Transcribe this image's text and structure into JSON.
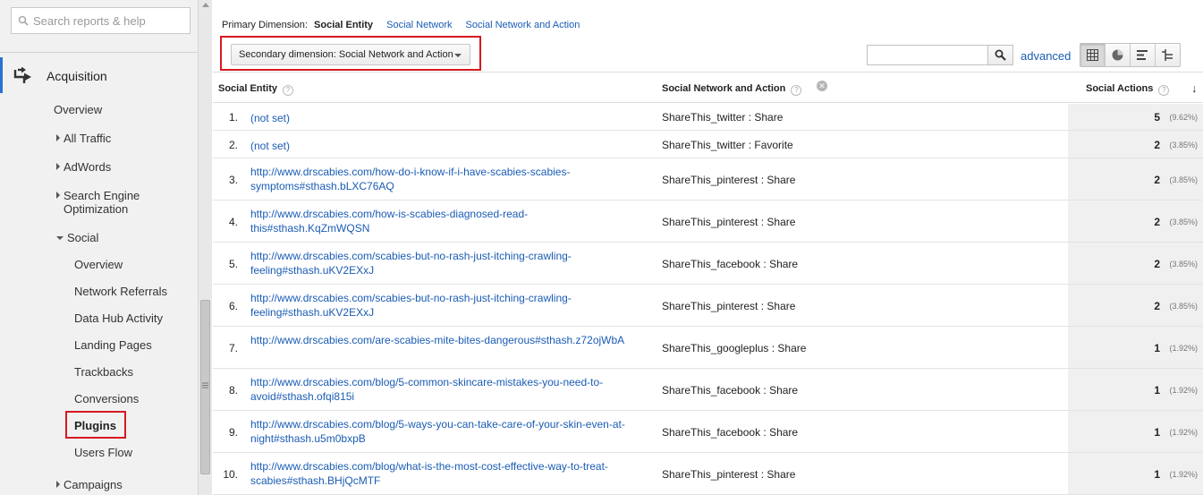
{
  "sidebar": {
    "search_placeholder": "Search reports & help",
    "section_label": "Acquisition",
    "items": [
      {
        "label": "Overview"
      },
      {
        "label": "All Traffic"
      },
      {
        "label": "AdWords"
      },
      {
        "label": "Search Engine"
      },
      {
        "label": "Optimization"
      },
      {
        "label": "Social"
      },
      {
        "label": "Overview"
      },
      {
        "label": "Network Referrals"
      },
      {
        "label": "Data Hub Activity"
      },
      {
        "label": "Landing Pages"
      },
      {
        "label": "Trackbacks"
      },
      {
        "label": "Conversions"
      },
      {
        "label": "Plugins"
      },
      {
        "label": "Users Flow"
      },
      {
        "label": "Campaigns"
      }
    ]
  },
  "primary_dimension": {
    "label": "Primary Dimension:",
    "current": "Social Entity",
    "options": [
      "Social Network",
      "Social Network and Action"
    ]
  },
  "secondary_dimension": {
    "label": "Secondary dimension: Social Network and Action"
  },
  "toolbar": {
    "advanced_label": "advanced",
    "search_value": ""
  },
  "table": {
    "headers": {
      "entity": "Social Entity",
      "network_action": "Social Network and Action",
      "actions": "Social Actions",
      "help_mark": "?",
      "remove_mark": "✕",
      "sort_mark": "↓"
    },
    "rows": [
      {
        "num": "1.",
        "entity": "(not set)",
        "network": "ShareThis_twitter : Share",
        "value": "5",
        "pct": "(9.62%)"
      },
      {
        "num": "2.",
        "entity": "(not set)",
        "network": "ShareThis_twitter : Favorite",
        "value": "2",
        "pct": "(3.85%)"
      },
      {
        "num": "3.",
        "entity": "http://www.drscabies.com/how-do-i-know-if-i-have-scabies-scabies-symptoms#sthash.bLXC76AQ",
        "network": "ShareThis_pinterest : Share",
        "value": "2",
        "pct": "(3.85%)"
      },
      {
        "num": "4.",
        "entity": "http://www.drscabies.com/how-is-scabies-diagnosed-read-this#sthash.KqZmWQSN",
        "network": "ShareThis_pinterest : Share",
        "value": "2",
        "pct": "(3.85%)"
      },
      {
        "num": "5.",
        "entity": "http://www.drscabies.com/scabies-but-no-rash-just-itching-crawling-feeling#sthash.uKV2EXxJ",
        "network": "ShareThis_facebook : Share",
        "value": "2",
        "pct": "(3.85%)"
      },
      {
        "num": "6.",
        "entity": "http://www.drscabies.com/scabies-but-no-rash-just-itching-crawling-feeling#sthash.uKV2EXxJ",
        "network": "ShareThis_pinterest : Share",
        "value": "2",
        "pct": "(3.85%)"
      },
      {
        "num": "7.",
        "entity": "http://www.drscabies.com/are-scabies-mite-bites-dangerous#sthash.z72ojWbA",
        "network": "ShareThis_googleplus : Share",
        "value": "1",
        "pct": "(1.92%)"
      },
      {
        "num": "8.",
        "entity": "http://www.drscabies.com/blog/5-common-skincare-mistakes-you-need-to-avoid#sthash.ofqi815i",
        "network": "ShareThis_facebook : Share",
        "value": "1",
        "pct": "(1.92%)"
      },
      {
        "num": "9.",
        "entity": "http://www.drscabies.com/blog/5-ways-you-can-take-care-of-your-skin-even-at-night#sthash.u5m0bxpB",
        "network": "ShareThis_facebook : Share",
        "value": "1",
        "pct": "(1.92%)"
      },
      {
        "num": "10.",
        "entity": "http://www.drscabies.com/blog/what-is-the-most-cost-effective-way-to-treat-scabies#sthash.BHjQcMTF",
        "network": "ShareThis_pinterest : Share",
        "value": "1",
        "pct": "(1.92%)"
      }
    ]
  },
  "colors": {
    "link": "#1a5cb4",
    "highlight_box": "#d71920",
    "active_bar": "#2a72d5"
  }
}
